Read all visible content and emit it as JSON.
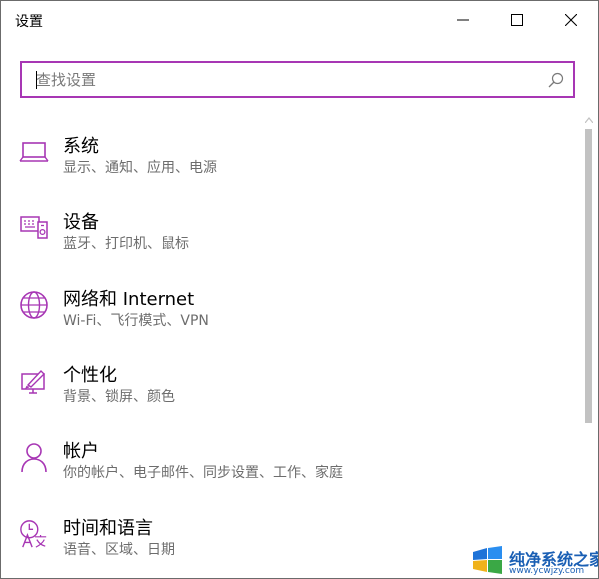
{
  "window": {
    "title": "设置"
  },
  "search": {
    "placeholder": "查找设置",
    "value": ""
  },
  "accent": "#a736b4",
  "items": [
    {
      "label": "系统",
      "desc": "显示、通知、应用、电源",
      "icon": "laptop-icon"
    },
    {
      "label": "设备",
      "desc": "蓝牙、打印机、鼠标",
      "icon": "devices-icon"
    },
    {
      "label": "网络和 Internet",
      "desc": "Wi-Fi、飞行模式、VPN",
      "icon": "globe-icon"
    },
    {
      "label": "个性化",
      "desc": "背景、锁屏、颜色",
      "icon": "personalization-icon"
    },
    {
      "label": "帐户",
      "desc": "你的帐户、电子邮件、同步设置、工作、家庭",
      "icon": "person-icon"
    },
    {
      "label": "时间和语言",
      "desc": "语音、区域、日期",
      "icon": "time-language-icon"
    }
  ],
  "watermark": {
    "text": "纯净系统之家",
    "url": "www.ycwjzy.com"
  }
}
